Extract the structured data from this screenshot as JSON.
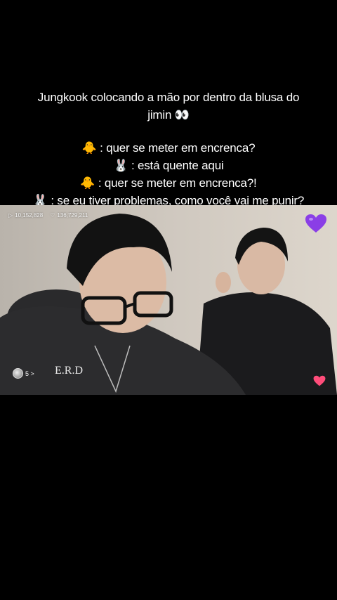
{
  "caption": {
    "line1": "Jungkook colocando a mão por dentro da blusa do",
    "line2": "jimin 👀",
    "line3": "🐥 : quer se meter em encrenca?",
    "line4": "🐰 : está quente aqui",
    "line5": "🐥 : quer se meter em encrenca?!",
    "line6": "🐰 : se eu tiver problemas, como você vai me punir?"
  },
  "video": {
    "views": "10,152,828",
    "likes": "136,729,211",
    "viewers": "5 >"
  },
  "colors": {
    "purple_heart": "#8a3ee6",
    "pink_heart": "#ff4d7a"
  }
}
